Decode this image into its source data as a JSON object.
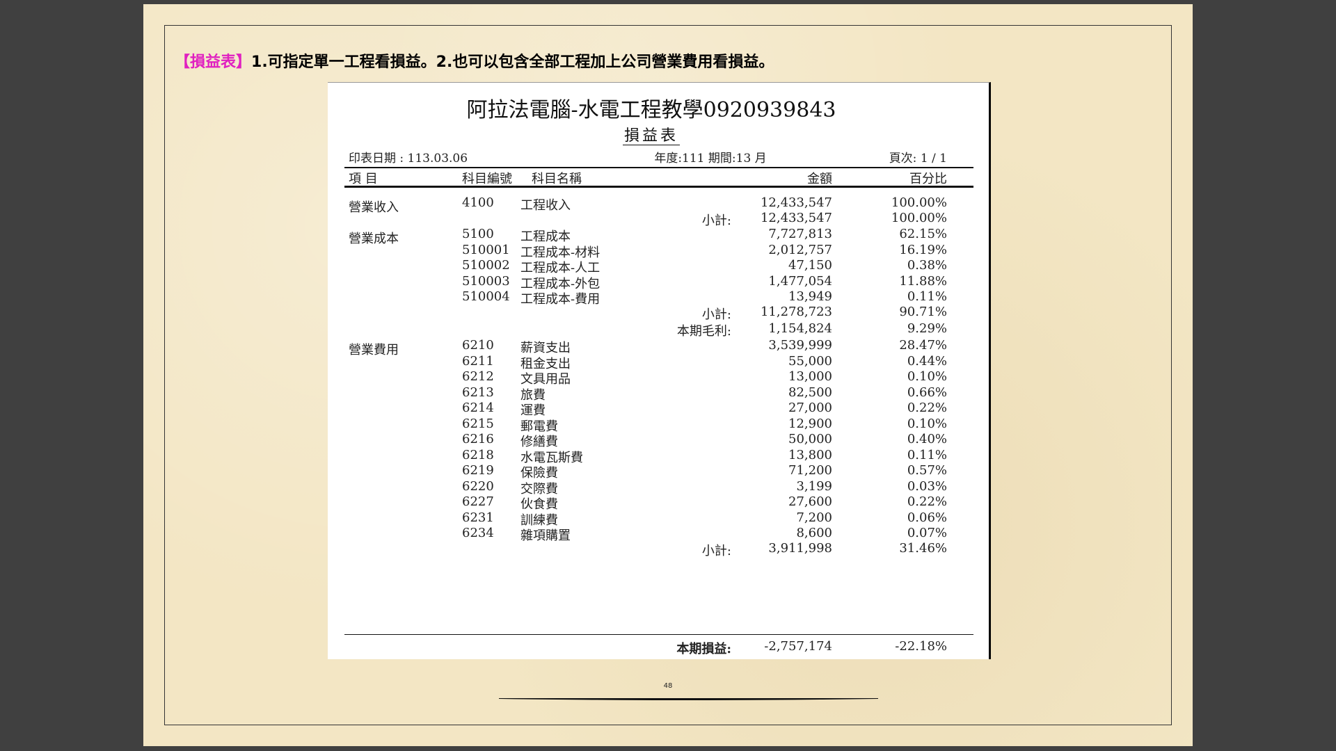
{
  "heading": {
    "tag": "【損益表】",
    "text": "1.可指定單一工程看損益。2.也可以包含全部工程加上公司營業費用看損益。"
  },
  "report": {
    "company": "阿拉法電腦-水電工程教學0920939843",
    "title": "損益表",
    "print_date": "印表日期 : 113.03.06",
    "period": "年度:111 期間:13 月",
    "page": "頁次: 1 / 1",
    "columns": {
      "item": "項 目",
      "code": "科目編號",
      "name": "科目名稱",
      "amount": "金額",
      "percent": "百分比"
    },
    "rows": [
      {
        "category": "營業收入",
        "code": "4100",
        "name": "工程收入",
        "amount": "12,433,547",
        "percent": "100.00%"
      },
      {
        "label": "小計:",
        "amount": "12,433,547",
        "percent": "100.00%"
      },
      {
        "category": "營業成本",
        "code": "5100",
        "name": "工程成本",
        "amount": "7,727,813",
        "percent": "62.15%"
      },
      {
        "code": "510001",
        "name": "工程成本-材料",
        "amount": "2,012,757",
        "percent": "16.19%"
      },
      {
        "code": "510002",
        "name": "工程成本-人工",
        "amount": "47,150",
        "percent": "0.38%"
      },
      {
        "code": "510003",
        "name": "工程成本-外包",
        "amount": "1,477,054",
        "percent": "11.88%"
      },
      {
        "code": "510004",
        "name": "工程成本-費用",
        "amount": "13,949",
        "percent": "0.11%"
      },
      {
        "label": "小計:",
        "amount": "11,278,723",
        "percent": "90.71%"
      },
      {
        "label": "本期毛利:",
        "amount": "1,154,824",
        "percent": "9.29%"
      },
      {
        "category": "營業費用",
        "code": "6210",
        "name": "薪資支出",
        "amount": "3,539,999",
        "percent": "28.47%"
      },
      {
        "code": "6211",
        "name": "租金支出",
        "amount": "55,000",
        "percent": "0.44%"
      },
      {
        "code": "6212",
        "name": "文具用品",
        "amount": "13,000",
        "percent": "0.10%"
      },
      {
        "code": "6213",
        "name": "旅費",
        "amount": "82,500",
        "percent": "0.66%"
      },
      {
        "code": "6214",
        "name": "運費",
        "amount": "27,000",
        "percent": "0.22%"
      },
      {
        "code": "6215",
        "name": "郵電費",
        "amount": "12,900",
        "percent": "0.10%"
      },
      {
        "code": "6216",
        "name": "修繕費",
        "amount": "50,000",
        "percent": "0.40%"
      },
      {
        "code": "6218",
        "name": "水電瓦斯費",
        "amount": "13,800",
        "percent": "0.11%"
      },
      {
        "code": "6219",
        "name": "保險費",
        "amount": "71,200",
        "percent": "0.57%"
      },
      {
        "code": "6220",
        "name": "交際費",
        "amount": "3,199",
        "percent": "0.03%"
      },
      {
        "code": "6227",
        "name": "伙食費",
        "amount": "27,600",
        "percent": "0.22%"
      },
      {
        "code": "6231",
        "name": "訓練費",
        "amount": "7,200",
        "percent": "0.06%"
      },
      {
        "code": "6234",
        "name": "雜項購置",
        "amount": "8,600",
        "percent": "0.07%"
      },
      {
        "label": "小計:",
        "amount": "3,911,998",
        "percent": "31.46%"
      }
    ],
    "total": {
      "label": "本期損益:",
      "amount": "-2,757,174",
      "percent": "-22.18%"
    }
  },
  "page_number": "48"
}
